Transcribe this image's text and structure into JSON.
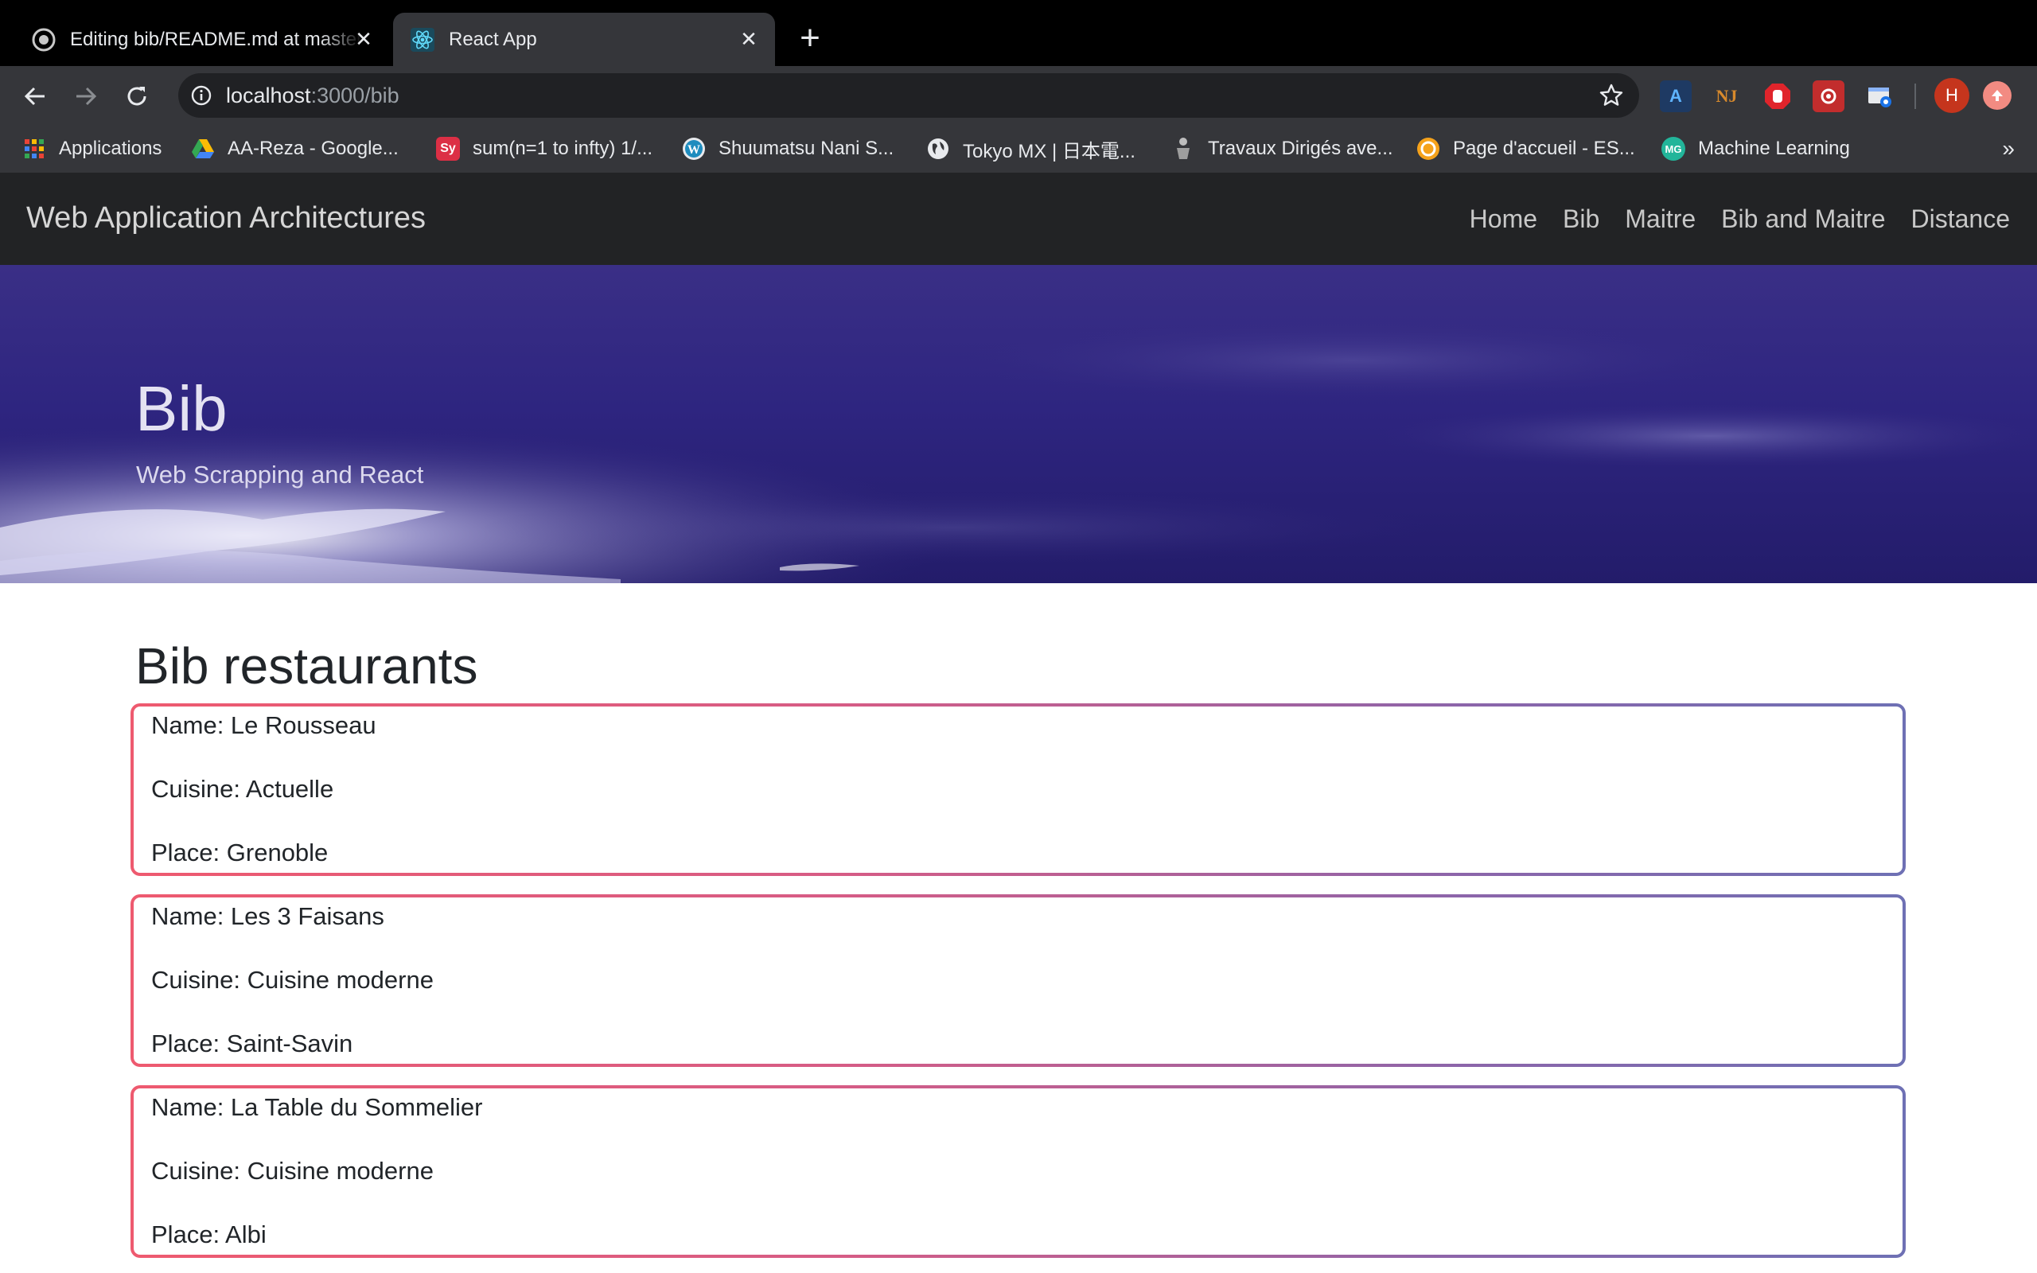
{
  "browser": {
    "tabs": [
      {
        "title": "Editing bib/README.md at master",
        "favicon": "github-icon",
        "active": false
      },
      {
        "title": "React App",
        "favicon": "react-icon",
        "active": true
      }
    ],
    "url_host": "localhost",
    "url_path": ":3000/bib",
    "profile_initial": "H",
    "bookmarks": [
      {
        "label": "Applications",
        "icon": "apps-grid-icon"
      },
      {
        "label": "AA-Reza - Google...",
        "icon": "google-drive-icon"
      },
      {
        "label": "sum(n=1 to infty) 1/...",
        "icon": "symbolab-icon",
        "icon_text": "Sy"
      },
      {
        "label": "Shuumatsu Nani S...",
        "icon": "wordpress-icon"
      },
      {
        "label": "Tokyo MX | 日本電...",
        "icon": "globe-icon"
      },
      {
        "label": "Travaux Dirigés ave...",
        "icon": "figure-icon"
      },
      {
        "label": "Page d'accueil - ES...",
        "icon": "esilv-icon"
      },
      {
        "label": "Machine Learning",
        "icon": "mg-icon",
        "icon_text": "MG"
      }
    ],
    "bookmarks_overflow": "»"
  },
  "navbar": {
    "brand": "Web Application Architectures",
    "links": [
      "Home",
      "Bib",
      "Maitre",
      "Bib and Maitre",
      "Distance"
    ]
  },
  "hero": {
    "title": "Bib",
    "subtitle": "Web Scrapping and React"
  },
  "section": {
    "title": "Bib restaurants"
  },
  "restaurants": [
    {
      "name": "Name: Le Rousseau",
      "cuisine": "Cuisine: Actuelle",
      "place": "Place: Grenoble"
    },
    {
      "name": "Name: Les 3 Faisans",
      "cuisine": "Cuisine: Cuisine moderne",
      "place": "Place: Saint-Savin"
    },
    {
      "name": "Name: La Table du Sommelier",
      "cuisine": "Cuisine: Cuisine moderne",
      "place": "Place: Albi"
    }
  ],
  "colors": {
    "card_border_start": "#ee5a6f",
    "card_border_end": "#6e70b4",
    "navbar_bg": "#222325",
    "hero_bg": "#2e2580"
  }
}
